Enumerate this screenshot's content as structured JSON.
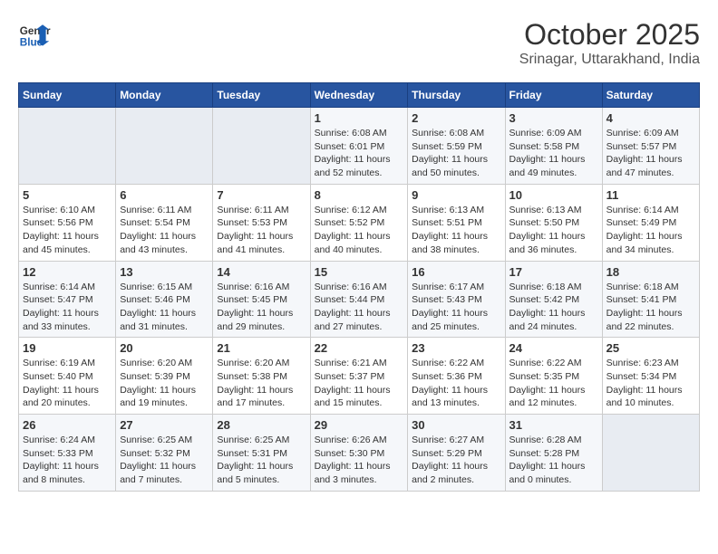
{
  "header": {
    "logo_line1": "General",
    "logo_line2": "Blue",
    "month": "October 2025",
    "location": "Srinagar, Uttarakhand, India"
  },
  "weekdays": [
    "Sunday",
    "Monday",
    "Tuesday",
    "Wednesday",
    "Thursday",
    "Friday",
    "Saturday"
  ],
  "weeks": [
    [
      {
        "day": "",
        "info": ""
      },
      {
        "day": "",
        "info": ""
      },
      {
        "day": "",
        "info": ""
      },
      {
        "day": "1",
        "info": "Sunrise: 6:08 AM\nSunset: 6:01 PM\nDaylight: 11 hours\nand 52 minutes."
      },
      {
        "day": "2",
        "info": "Sunrise: 6:08 AM\nSunset: 5:59 PM\nDaylight: 11 hours\nand 50 minutes."
      },
      {
        "day": "3",
        "info": "Sunrise: 6:09 AM\nSunset: 5:58 PM\nDaylight: 11 hours\nand 49 minutes."
      },
      {
        "day": "4",
        "info": "Sunrise: 6:09 AM\nSunset: 5:57 PM\nDaylight: 11 hours\nand 47 minutes."
      }
    ],
    [
      {
        "day": "5",
        "info": "Sunrise: 6:10 AM\nSunset: 5:56 PM\nDaylight: 11 hours\nand 45 minutes."
      },
      {
        "day": "6",
        "info": "Sunrise: 6:11 AM\nSunset: 5:54 PM\nDaylight: 11 hours\nand 43 minutes."
      },
      {
        "day": "7",
        "info": "Sunrise: 6:11 AM\nSunset: 5:53 PM\nDaylight: 11 hours\nand 41 minutes."
      },
      {
        "day": "8",
        "info": "Sunrise: 6:12 AM\nSunset: 5:52 PM\nDaylight: 11 hours\nand 40 minutes."
      },
      {
        "day": "9",
        "info": "Sunrise: 6:13 AM\nSunset: 5:51 PM\nDaylight: 11 hours\nand 38 minutes."
      },
      {
        "day": "10",
        "info": "Sunrise: 6:13 AM\nSunset: 5:50 PM\nDaylight: 11 hours\nand 36 minutes."
      },
      {
        "day": "11",
        "info": "Sunrise: 6:14 AM\nSunset: 5:49 PM\nDaylight: 11 hours\nand 34 minutes."
      }
    ],
    [
      {
        "day": "12",
        "info": "Sunrise: 6:14 AM\nSunset: 5:47 PM\nDaylight: 11 hours\nand 33 minutes."
      },
      {
        "day": "13",
        "info": "Sunrise: 6:15 AM\nSunset: 5:46 PM\nDaylight: 11 hours\nand 31 minutes."
      },
      {
        "day": "14",
        "info": "Sunrise: 6:16 AM\nSunset: 5:45 PM\nDaylight: 11 hours\nand 29 minutes."
      },
      {
        "day": "15",
        "info": "Sunrise: 6:16 AM\nSunset: 5:44 PM\nDaylight: 11 hours\nand 27 minutes."
      },
      {
        "day": "16",
        "info": "Sunrise: 6:17 AM\nSunset: 5:43 PM\nDaylight: 11 hours\nand 25 minutes."
      },
      {
        "day": "17",
        "info": "Sunrise: 6:18 AM\nSunset: 5:42 PM\nDaylight: 11 hours\nand 24 minutes."
      },
      {
        "day": "18",
        "info": "Sunrise: 6:18 AM\nSunset: 5:41 PM\nDaylight: 11 hours\nand 22 minutes."
      }
    ],
    [
      {
        "day": "19",
        "info": "Sunrise: 6:19 AM\nSunset: 5:40 PM\nDaylight: 11 hours\nand 20 minutes."
      },
      {
        "day": "20",
        "info": "Sunrise: 6:20 AM\nSunset: 5:39 PM\nDaylight: 11 hours\nand 19 minutes."
      },
      {
        "day": "21",
        "info": "Sunrise: 6:20 AM\nSunset: 5:38 PM\nDaylight: 11 hours\nand 17 minutes."
      },
      {
        "day": "22",
        "info": "Sunrise: 6:21 AM\nSunset: 5:37 PM\nDaylight: 11 hours\nand 15 minutes."
      },
      {
        "day": "23",
        "info": "Sunrise: 6:22 AM\nSunset: 5:36 PM\nDaylight: 11 hours\nand 13 minutes."
      },
      {
        "day": "24",
        "info": "Sunrise: 6:22 AM\nSunset: 5:35 PM\nDaylight: 11 hours\nand 12 minutes."
      },
      {
        "day": "25",
        "info": "Sunrise: 6:23 AM\nSunset: 5:34 PM\nDaylight: 11 hours\nand 10 minutes."
      }
    ],
    [
      {
        "day": "26",
        "info": "Sunrise: 6:24 AM\nSunset: 5:33 PM\nDaylight: 11 hours\nand 8 minutes."
      },
      {
        "day": "27",
        "info": "Sunrise: 6:25 AM\nSunset: 5:32 PM\nDaylight: 11 hours\nand 7 minutes."
      },
      {
        "day": "28",
        "info": "Sunrise: 6:25 AM\nSunset: 5:31 PM\nDaylight: 11 hours\nand 5 minutes."
      },
      {
        "day": "29",
        "info": "Sunrise: 6:26 AM\nSunset: 5:30 PM\nDaylight: 11 hours\nand 3 minutes."
      },
      {
        "day": "30",
        "info": "Sunrise: 6:27 AM\nSunset: 5:29 PM\nDaylight: 11 hours\nand 2 minutes."
      },
      {
        "day": "31",
        "info": "Sunrise: 6:28 AM\nSunset: 5:28 PM\nDaylight: 11 hours\nand 0 minutes."
      },
      {
        "day": "",
        "info": ""
      }
    ]
  ]
}
